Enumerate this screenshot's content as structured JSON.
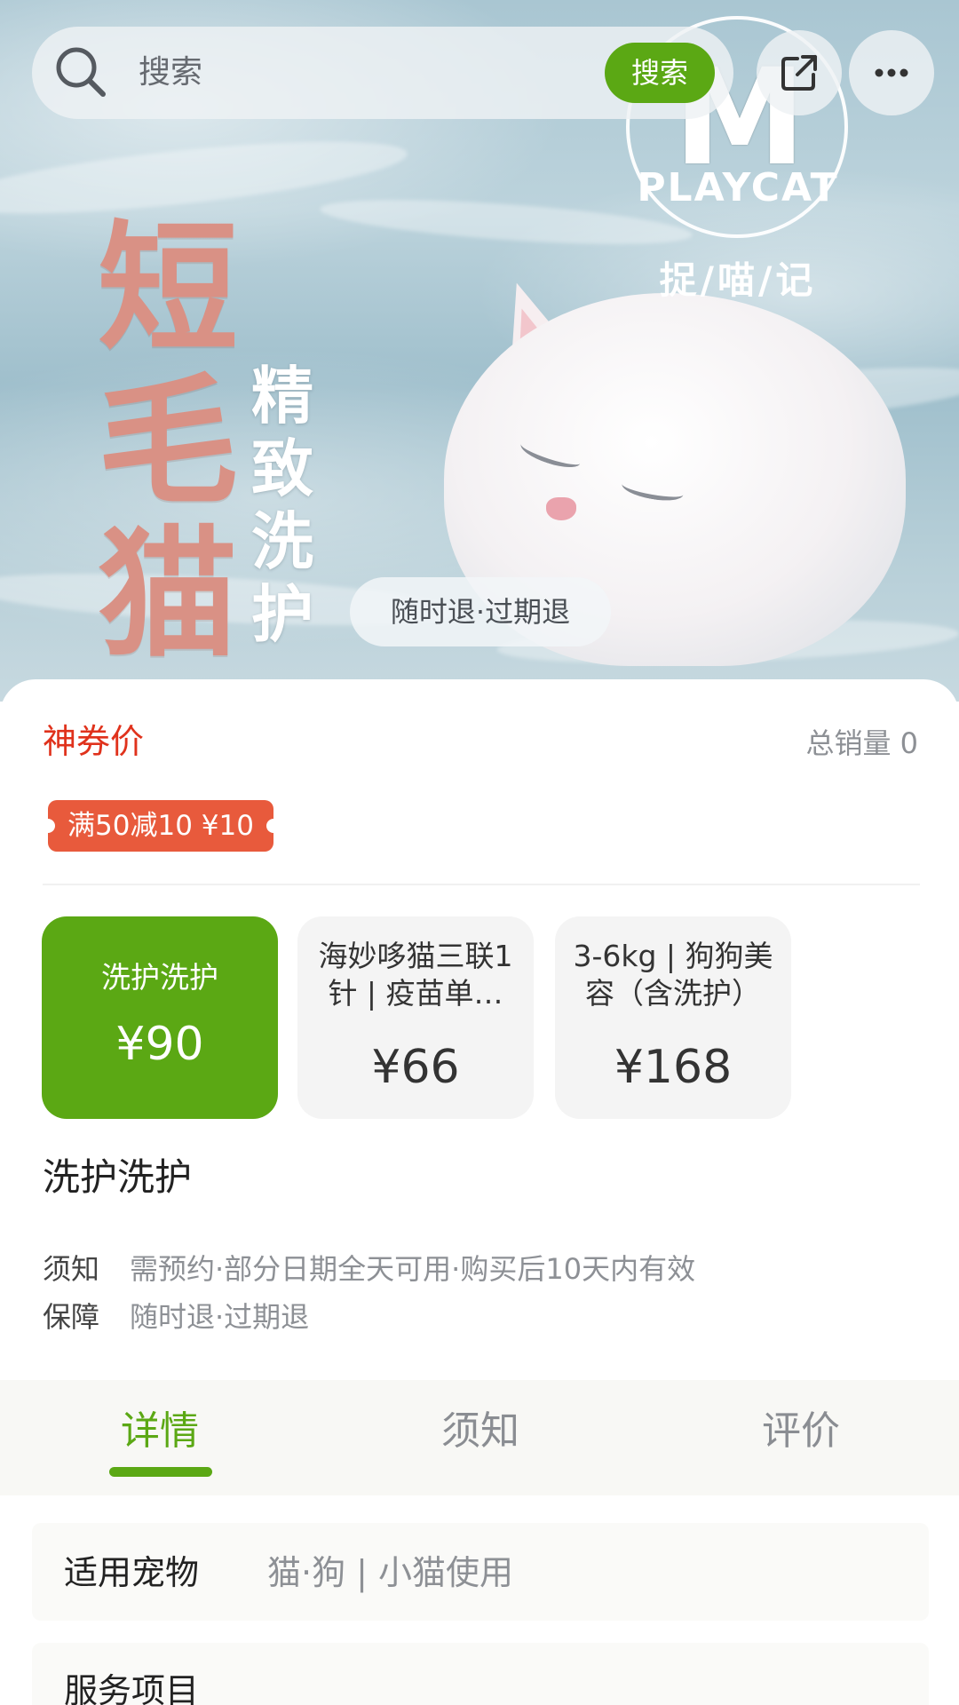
{
  "search": {
    "placeholder": "搜索",
    "button_label": "搜索"
  },
  "poster": {
    "title_lines": [
      "短",
      "毛",
      "猫"
    ],
    "subtitle_lines": [
      "精",
      "致",
      "洗",
      "护"
    ],
    "logo_letter": "M",
    "logo_word": "PLAYCAT",
    "logo_cn": "捉/喵/记",
    "refund_pill": "随时退·过期退"
  },
  "header": {
    "deal_price_label": "神券价",
    "total_sales": "总销量 0"
  },
  "coupon": {
    "text": "满50减10 ¥10"
  },
  "skus": [
    {
      "name": "洗护洗护",
      "price": "¥90",
      "selected": true
    },
    {
      "name": "海妙哆猫三联1针 | 疫苗单…",
      "price": "¥66",
      "selected": false
    },
    {
      "name": "3-6kg | 狗狗美容（含洗护）",
      "price": "¥168",
      "selected": false
    }
  ],
  "product": {
    "title": "洗护洗护",
    "notice_label": "须知",
    "notice_value": "需预约·部分日期全天可用·购买后10天内有效",
    "guarantee_label": "保障",
    "guarantee_value": "随时退·过期退"
  },
  "tabs": [
    {
      "label": "详情",
      "active": true
    },
    {
      "label": "须知",
      "active": false
    },
    {
      "label": "评价",
      "active": false
    }
  ],
  "details": {
    "pet_label": "适用宠物",
    "pet_value": "猫·狗 | 小猫使用",
    "service_label": "服务项目"
  },
  "colors": {
    "accent_green": "#5ba814",
    "price_red": "#e0321c",
    "coupon_orange": "#e85a3c",
    "poster_pink": "#d99185"
  },
  "icons": {
    "search": "search-icon",
    "share": "share-icon",
    "more": "more-icon"
  }
}
